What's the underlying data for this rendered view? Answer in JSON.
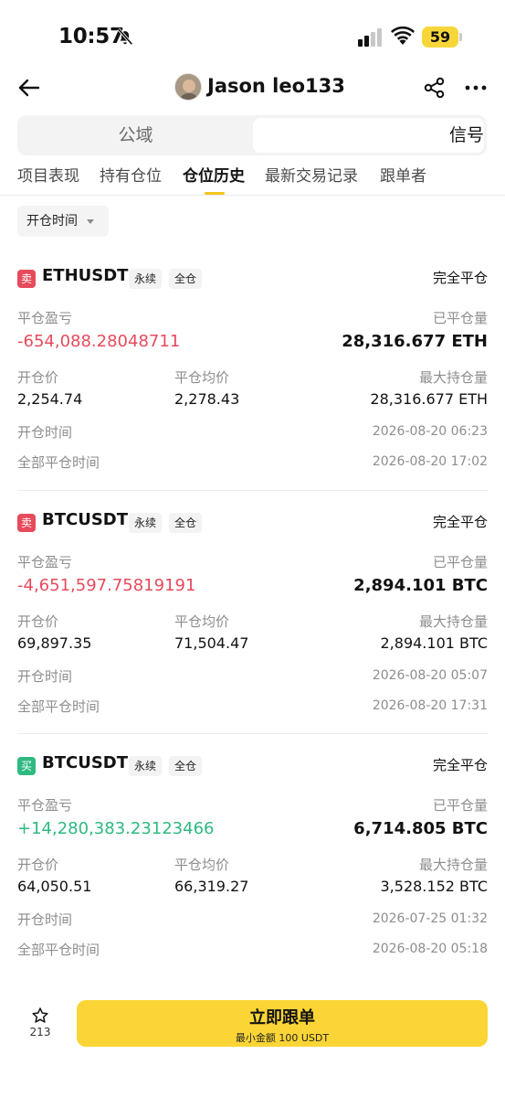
{
  "status_bar": {
    "time": "10:57",
    "battery": "59"
  },
  "header": {
    "username": "Jason leo133"
  },
  "segment": {
    "left": "公域",
    "right": "信号"
  },
  "tabs": [
    "项目表现",
    "持有仓位",
    "仓位历史",
    "最新交易记录",
    "跟单者"
  ],
  "active_tab": "仓位历史",
  "filter": {
    "label": "开仓时间"
  },
  "labels": {
    "pnl": "平仓盈亏",
    "closed_qty": "已平仓量",
    "open_price": "开仓价",
    "close_avg_price": "平仓均价",
    "max_position": "最大持仓量",
    "open_time": "开仓时间",
    "full_close_time": "全部平仓时间"
  },
  "positions": [
    {
      "side": "卖",
      "symbol": "ETHUSDT",
      "tag1": "永续",
      "tag2": "全仓",
      "status": "完全平仓",
      "pnl": "-654,088.28048711",
      "closed_qty": "28,316.677 ETH",
      "open_price": "2,254.74",
      "close_avg_price": "2,278.43",
      "max_position": "28,316.677 ETH",
      "open_time": "2026-08-20 06:23",
      "full_close_time": "2026-08-20 17:02"
    },
    {
      "side": "卖",
      "symbol": "BTCUSDT",
      "tag1": "永续",
      "tag2": "全仓",
      "status": "完全平仓",
      "pnl": "-4,651,597.75819191",
      "closed_qty": "2,894.101 BTC",
      "open_price": "69,897.35",
      "close_avg_price": "71,504.47",
      "max_position": "2,894.101 BTC",
      "open_time": "2026-08-20 05:07",
      "full_close_time": "2026-08-20 17:31"
    },
    {
      "side": "买",
      "symbol": "BTCUSDT",
      "tag1": "永续",
      "tag2": "全仓",
      "status": "完全平仓",
      "pnl": "+14,280,383.23123466",
      "closed_qty": "6,714.805 BTC",
      "open_price": "64,050.51",
      "close_avg_price": "66,319.27",
      "max_position": "3,528.152 BTC",
      "open_time": "2026-07-25 01:32",
      "full_close_time": "2026-08-20 05:18"
    }
  ],
  "bottom": {
    "star_count": "213",
    "follow_label": "立即跟单",
    "follow_sub": "最小金额 100 USDT"
  },
  "colors": {
    "accent": "#fbd535",
    "sell": "#e64b5c",
    "buy": "#2eb981"
  }
}
